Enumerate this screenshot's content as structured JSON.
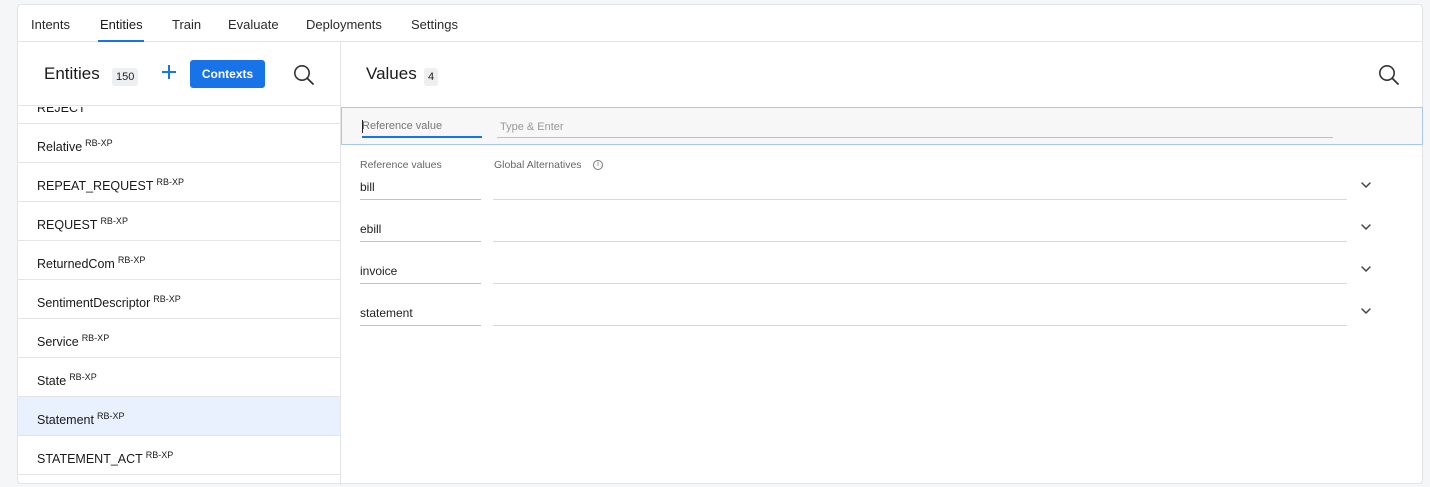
{
  "tabs": [
    {
      "label": "Intents",
      "active": false
    },
    {
      "label": "Entities",
      "active": true
    },
    {
      "label": "Train",
      "active": false
    },
    {
      "label": "Evaluate",
      "active": false
    },
    {
      "label": "Deployments",
      "active": false
    },
    {
      "label": "Settings",
      "active": false
    }
  ],
  "entities_panel": {
    "title": "Entities",
    "count": "150",
    "contexts_label": "Contexts",
    "add_icon": "plus-icon",
    "search_icon": "search-icon",
    "items": [
      {
        "name": "REJECT",
        "tag": "RB-XP",
        "selected": false
      },
      {
        "name": "Relative",
        "tag": "RB-XP",
        "selected": false
      },
      {
        "name": "REPEAT_REQUEST",
        "tag": "RB-XP",
        "selected": false
      },
      {
        "name": "REQUEST",
        "tag": "RB-XP",
        "selected": false
      },
      {
        "name": "ReturnedCom",
        "tag": "RB-XP",
        "selected": false
      },
      {
        "name": "SentimentDescriptor",
        "tag": "RB-XP",
        "selected": false
      },
      {
        "name": "Service",
        "tag": "RB-XP",
        "selected": false
      },
      {
        "name": "State",
        "tag": "RB-XP",
        "selected": false
      },
      {
        "name": "Statement",
        "tag": "RB-XP",
        "selected": true
      },
      {
        "name": "STATEMENT_ACT",
        "tag": "RB-XP",
        "selected": false
      }
    ]
  },
  "values_panel": {
    "title": "Values",
    "count": "4",
    "search_icon": "search-icon",
    "reference_placeholder": "Reference value",
    "alternatives_placeholder": "Type & Enter",
    "col_reference": "Reference values",
    "col_alternatives": "Global Alternatives",
    "values": [
      {
        "reference": "bill",
        "alternatives": ""
      },
      {
        "reference": "ebill",
        "alternatives": ""
      },
      {
        "reference": "invoice",
        "alternatives": ""
      },
      {
        "reference": "statement",
        "alternatives": ""
      }
    ]
  },
  "colors": {
    "accent": "#1973e8",
    "selected_row": "#e8f1fd"
  }
}
